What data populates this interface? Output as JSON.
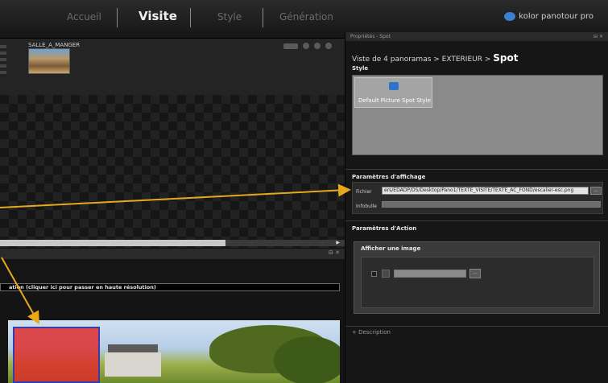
{
  "nav": {
    "tabs": [
      {
        "label": "Accueil"
      },
      {
        "label": "Visite"
      },
      {
        "label": "Style"
      },
      {
        "label": "Génération"
      }
    ],
    "brand": "kolor panotour pro"
  },
  "left": {
    "thumbnail_label": "SALLE_A_MANGER",
    "hires_text": "ation (cliquer ici pour passer en haute résolution)"
  },
  "properties": {
    "panel_title": "Propriétés - Spot",
    "breadcrumb_prefix": "Viste de 4 panoramas > EXTERIEUR > ",
    "breadcrumb_current": "Spot",
    "style_section": "Style",
    "style_tile_label": "Default Picture Spot Style",
    "display_section": "Paramètres d'affichage",
    "fichier_label": "Fichier",
    "fichier_value": "ers/EDADP/DS/Desktop/Pano1/TEXTE_VISITE/TEXTE_AC_FOND/escalier-esc.png",
    "infobulle_label": "Infobulle",
    "infobulle_value": "",
    "action_section": "Paramètres d'Action",
    "action_title": "Afficher une image",
    "browse_label": "...",
    "description_label": "+ Description"
  },
  "colors": {
    "arrow": "#e8a81c",
    "selection_fill": "#e12828",
    "selection_border": "#3a3aa8",
    "brand_icon": "#3c7fd0"
  }
}
